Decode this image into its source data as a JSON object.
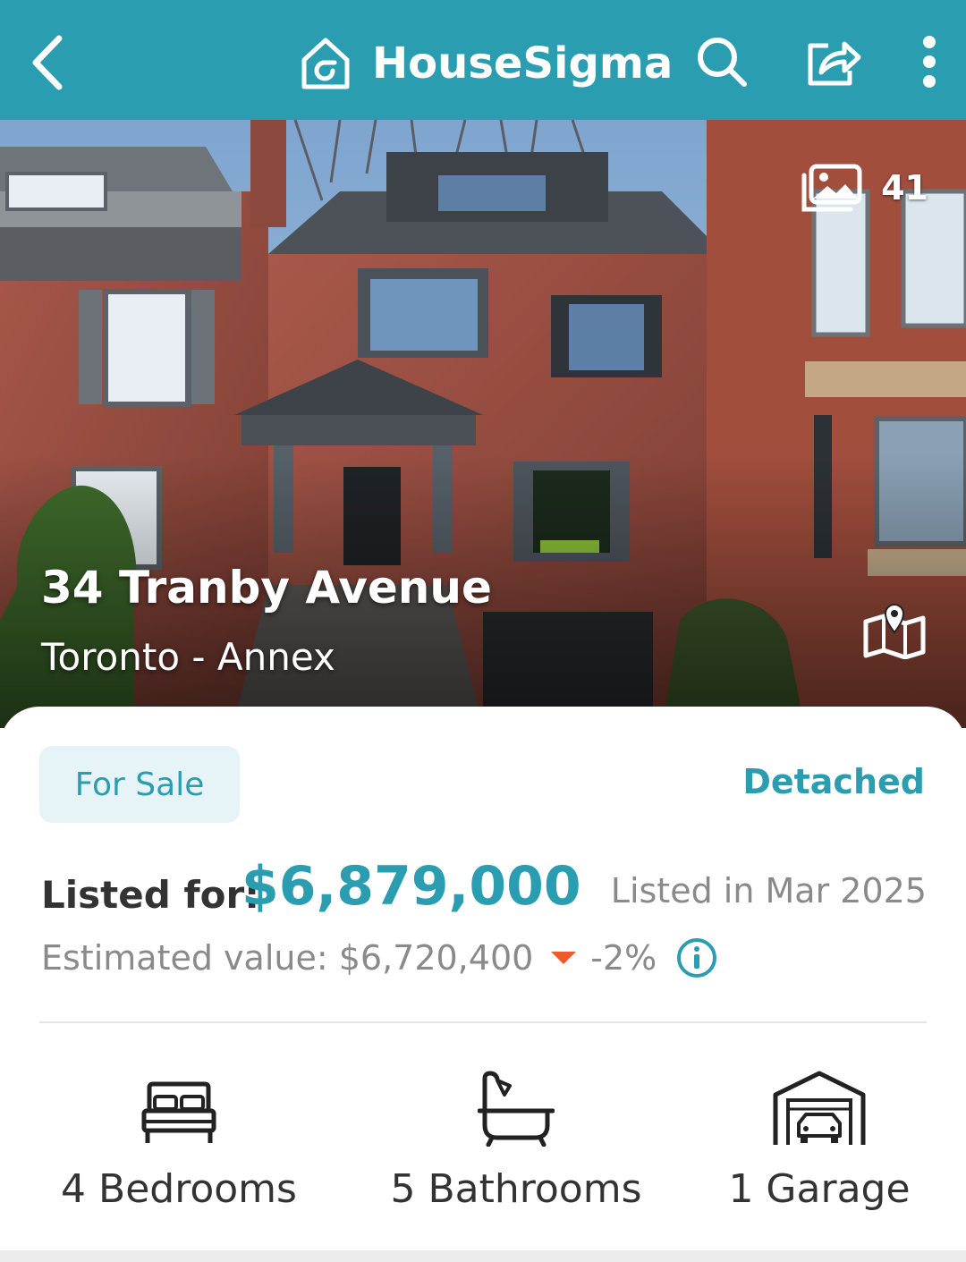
{
  "header": {
    "brand": "HouseSigma",
    "background": "#2a9db0",
    "icons": [
      "back-arrow-icon",
      "house-logo-icon",
      "search-icon",
      "share-icon",
      "more-vertical-icon"
    ]
  },
  "hero": {
    "photo_count": "41",
    "address": "34 Tranby Avenue",
    "locality": "Toronto - Annex",
    "icons": [
      "photo-gallery-icon",
      "map-pin-icon"
    ]
  },
  "listing": {
    "status": "For Sale",
    "property_type": "Detached",
    "price_label": "Listed for:",
    "price": "$6,879,000",
    "listed_date": "Listed in Mar 2025",
    "estimate_label": "Estimated value: $6,720,400",
    "estimate_change": "-2%",
    "accent_color": "#2a9db0",
    "down_color": "#f05a28"
  },
  "features": {
    "bedrooms": "4 Bedrooms",
    "bathrooms": "5 Bathrooms",
    "garage": "1 Garage"
  }
}
